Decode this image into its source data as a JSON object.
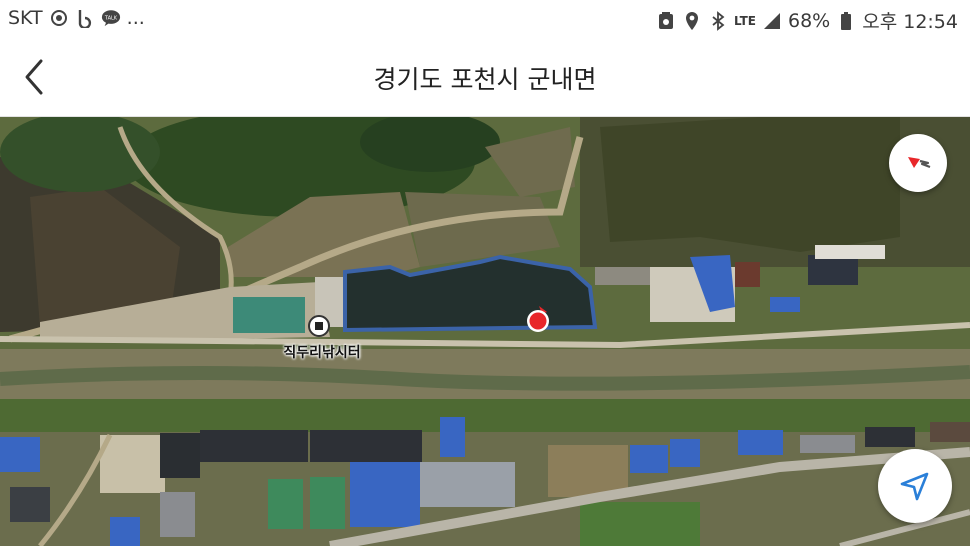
{
  "status_bar": {
    "carrier": "SKT",
    "more": "...",
    "network": "LTE",
    "battery": "68%",
    "time": "오후 12:54",
    "left_icons": [
      "sync-icon",
      "b-app-icon",
      "talk-icon"
    ],
    "right_icons": [
      "screenshot-icon",
      "location-icon",
      "bluetooth-icon",
      "signal-icon",
      "battery-icon"
    ]
  },
  "header": {
    "title": "경기도 포천시 군내면",
    "back_icon": "chevron-left-icon"
  },
  "map": {
    "type": "satellite",
    "poi": {
      "label": "직두리낚시터",
      "icon": "square-dot-icon"
    },
    "current_location_icon": "red-location-dot-icon",
    "compass_icon": "compass-needle-icon",
    "locate_icon": "navigation-arrow-icon",
    "colors": {
      "accent_blue": "#2a7fd8",
      "location_red": "#e8262a"
    }
  }
}
